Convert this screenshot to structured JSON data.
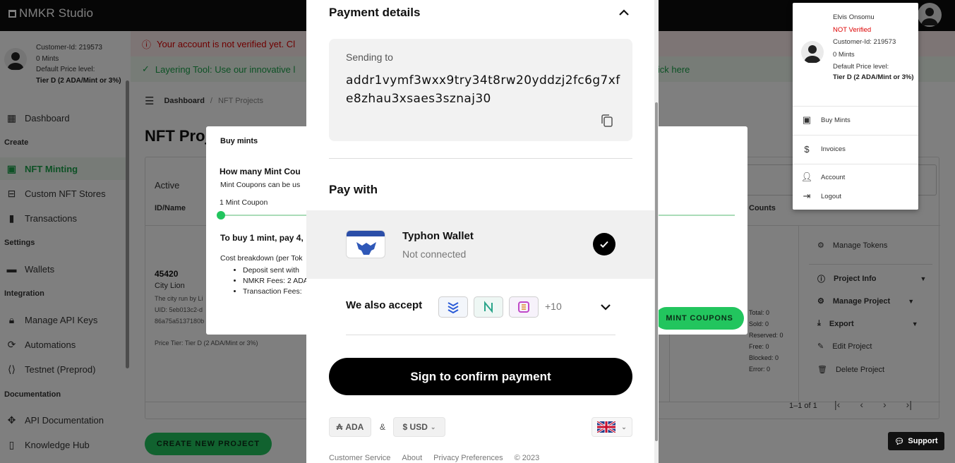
{
  "app": {
    "title": "NMKR Studio"
  },
  "sidebar": {
    "user": {
      "customer_id": "Customer-Id: 219573",
      "mints": "0 Mints",
      "price_label": "Default Price level:",
      "price_value": "Tier D (2 ADA/Mint or 3%)"
    },
    "items": [
      {
        "label": "Dashboard",
        "icon": "dashboard-icon"
      },
      {
        "label": "NFT Minting",
        "icon": "image-icon"
      },
      {
        "label": "Custom NFT Stores",
        "icon": "store-icon"
      },
      {
        "label": "Transactions",
        "icon": "bar-chart-icon"
      },
      {
        "label": "Wallets",
        "icon": "wallet-icon"
      },
      {
        "label": "Manage API Keys",
        "icon": "lock-icon"
      },
      {
        "label": "Automations",
        "icon": "automation-icon"
      },
      {
        "label": "Testnet (Preprod)",
        "icon": "code-icon"
      },
      {
        "label": "API Documentation",
        "icon": "api-icon"
      },
      {
        "label": "Knowledge Hub",
        "icon": "book-icon"
      }
    ],
    "sections": {
      "create": "Create",
      "settings": "Settings",
      "integration": "Integration",
      "documentation": "Documentation"
    }
  },
  "main": {
    "banner_red": "Your account is not verified yet. Cl",
    "banner_green": "Layering Tool: Use our innovative l",
    "banner_green_link": "lick here",
    "breadcrumb": {
      "home": "Dashboard",
      "sep": "/",
      "current": "NFT Projects"
    },
    "page_title": "NFT Proj",
    "tab_active": "Active",
    "col_idname": "ID/Name",
    "col_counts": "Counts",
    "project": {
      "id": "45420",
      "name": "City Lion",
      "desc": "The city run by Li",
      "uid": "UID: 5eb013c2-d",
      "uid2": "86a75a5137180b",
      "price": "Price Tier: Tier D (2 ADA/Mint or 3%)"
    },
    "counts": [
      "Total: 0",
      "Sold: 0",
      "Reserved: 0",
      "Free: 0",
      "Blocked: 0",
      "Error: 0"
    ],
    "actions": [
      {
        "label": "Manage Tokens",
        "icon": "gear-icon"
      },
      {
        "label": "Project Info",
        "icon": "info-icon"
      },
      {
        "label": "Manage Project",
        "icon": "gear-icon"
      },
      {
        "label": "Export",
        "icon": "download-icon"
      },
      {
        "label": "Edit Project",
        "icon": "edit-icon"
      },
      {
        "label": "Delete Project",
        "icon": "trash-icon"
      }
    ],
    "pagination": "1–1 of 1",
    "create_button": "CREATE NEW PROJECT",
    "support": "Support"
  },
  "buy_dialog": {
    "title": "Buy mints",
    "question": "How many Mint Cou",
    "sub": "Mint Coupons can be us",
    "coupon": "1 Mint Coupon",
    "to_buy": "To buy 1 mint, pay 4,",
    "breakdown": "Cost breakdown (per Tok",
    "bullets": [
      "Deposit sent with",
      "NMKR Fees: 2 ADA",
      "Transaction Fees:"
    ],
    "mint_button": "MINT COUPONS"
  },
  "payment": {
    "title": "Payment details",
    "sending_to_label": "Sending to",
    "address": "addr1vymf3wxx9try34t8rw20yddzj2fc6g7xfe8zhau3xsaes3sznaj30",
    "pay_with": "Pay with",
    "wallet": {
      "name": "Typhon Wallet",
      "status": "Not connected"
    },
    "also_accept": "We also accept",
    "more_count": "+10",
    "sign_button": "Sign to confirm payment",
    "currency_ada": "ADA",
    "amp": "&",
    "currency_usd": "$ USD",
    "footer": [
      "Customer Service",
      "About",
      "Privacy Preferences",
      "© 2023"
    ]
  },
  "account_menu": {
    "name": "Elvis Onsomu",
    "status": "NOT Verified",
    "customer_id": "Customer-Id: 219573",
    "mints": "0 Mints",
    "price_label": "Default Price level:",
    "price_value": "Tier D (2 ADA/Mint or 3%)",
    "items": [
      {
        "label": "Buy Mints",
        "icon": "wallet-icon"
      },
      {
        "label": "Invoices",
        "icon": "dollar-icon"
      },
      {
        "label": "Account",
        "icon": "user-icon"
      },
      {
        "label": "Logout",
        "icon": "logout-icon"
      }
    ]
  },
  "colors": {
    "accent": "#22c55e",
    "error": "#dd0000",
    "dark": "#0d0d0d"
  }
}
